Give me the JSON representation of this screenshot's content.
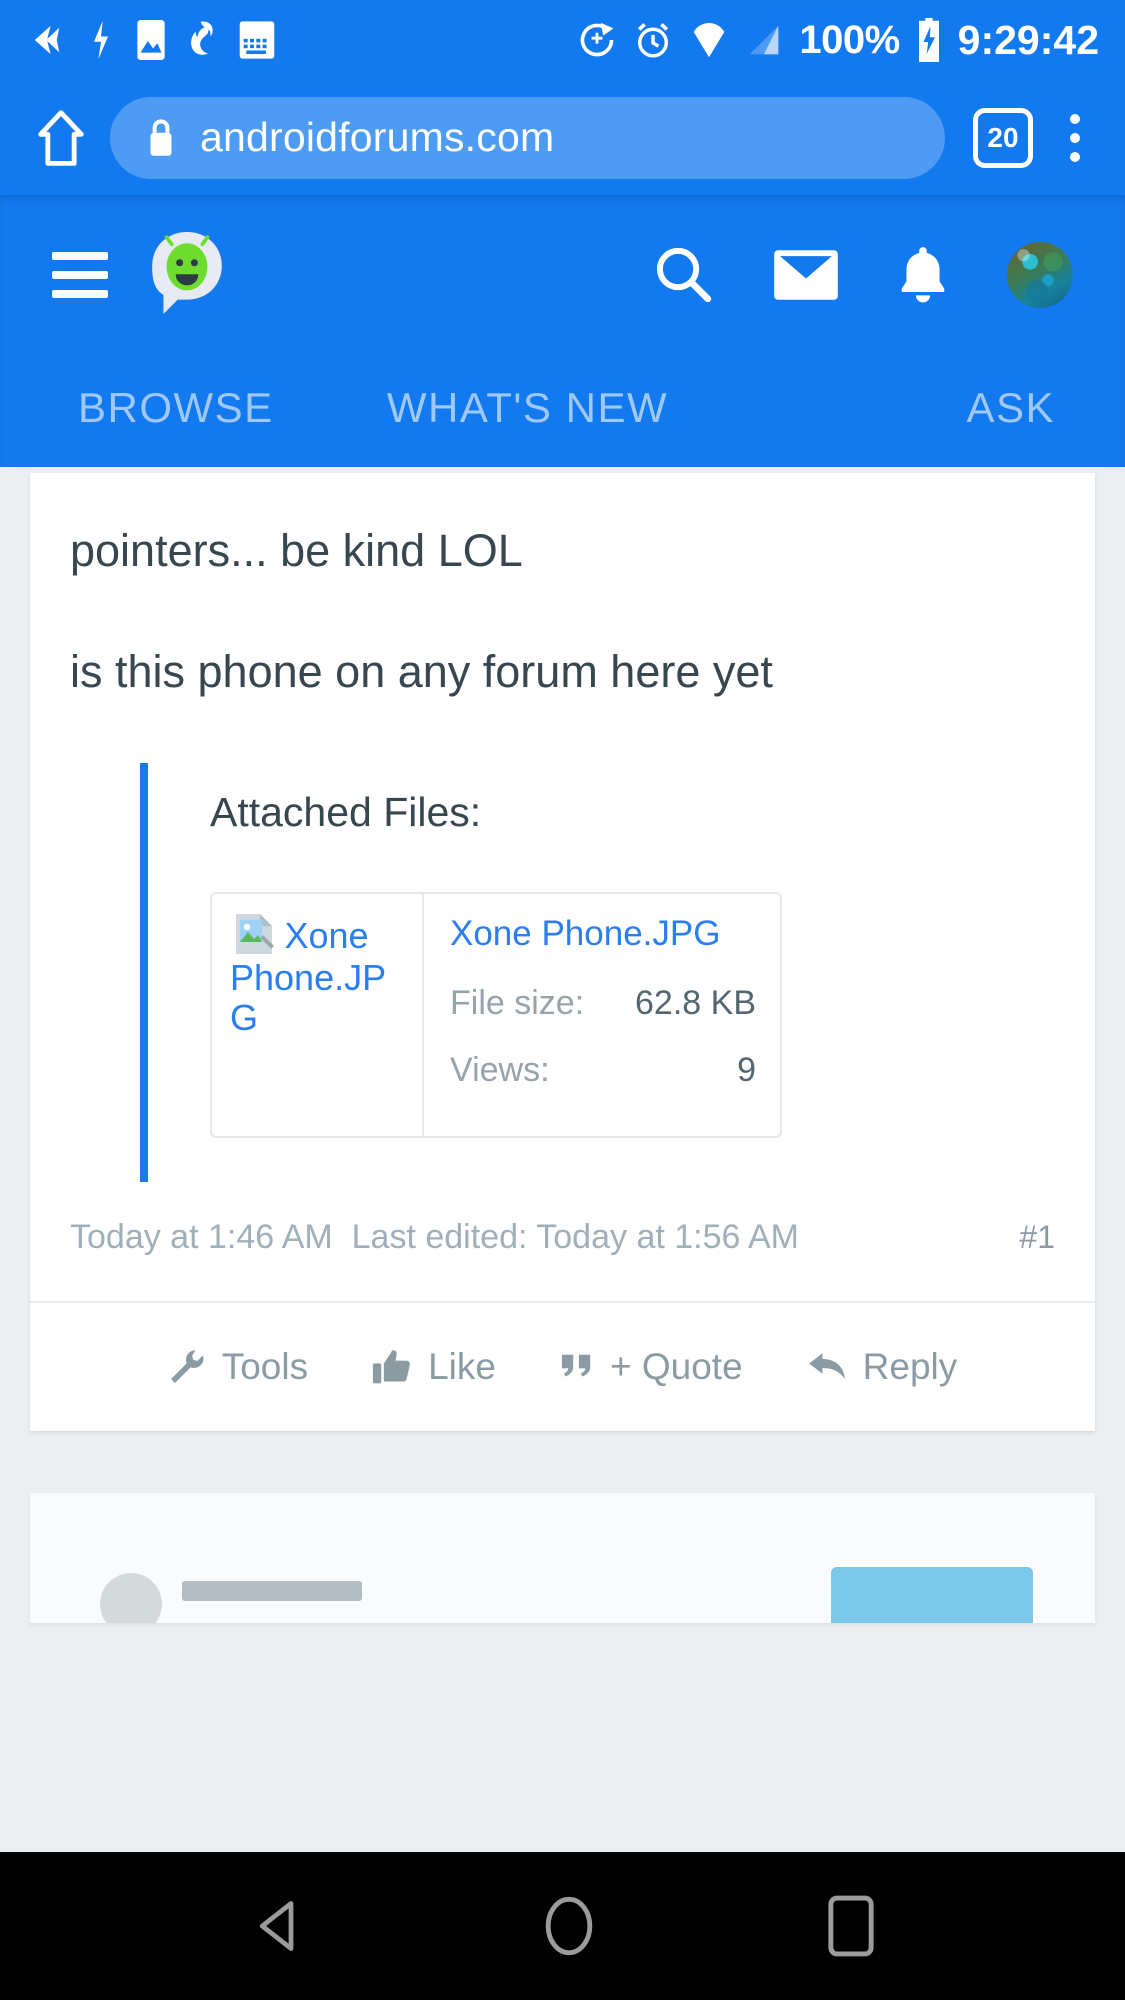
{
  "status_bar": {
    "icons": [
      "back-arrow-icon",
      "flash-icon",
      "photo-icon",
      "firefox-icon",
      "keyboard-icon",
      "sync-icon",
      "alarm-icon",
      "location-icon",
      "signal-icon"
    ],
    "battery_percent": "100%",
    "battery_icon": "battery-charging-icon",
    "clock": "9:29:42"
  },
  "browser": {
    "home_icon": "home-icon",
    "lock_icon": "lock-icon",
    "url": "androidforums.com",
    "tab_count": "20",
    "menu_icon": "kebab-menu-icon"
  },
  "forum_header": {
    "menu_icon": "hamburger-menu-icon",
    "logo_icon": "android-forums-logo-icon",
    "actions": [
      "search-icon",
      "inbox-icon",
      "bell-icon",
      "avatar"
    ],
    "tabs": [
      {
        "label": "BROWSE"
      },
      {
        "label": "WHAT'S NEW"
      },
      {
        "label": "ASK"
      }
    ]
  },
  "post": {
    "paragraphs": [
      "pointers... be kind LOL",
      "is this phone on any forum here yet"
    ],
    "attachments_title": "Attached Files:",
    "attachment": {
      "thumb_alt": "Xone Phone.JPG",
      "thumb_icon": "broken-image-icon",
      "name": "Xone Phone.JPG",
      "filesize_label": "File size:",
      "filesize_value": "62.8 KB",
      "views_label": "Views:",
      "views_value": "9"
    },
    "posted_at": "Today at 1:46 AM",
    "last_edited": "Last edited: Today at 1:56 AM",
    "post_number": "#1",
    "actions": [
      {
        "label": "Tools",
        "icon": "wrench-icon"
      },
      {
        "label": "Like",
        "icon": "thumbs-up-icon"
      },
      {
        "label": "+ Quote",
        "icon": "quote-icon"
      },
      {
        "label": "Reply",
        "icon": "reply-arrow-icon"
      }
    ]
  },
  "nav_bar": {
    "back_icon": "back-triangle-icon",
    "home_icon": "home-circle-icon",
    "recents_icon": "recents-square-icon"
  },
  "colors": {
    "brand_blue": "#1379ee",
    "omnibox_blue": "#4e9bf4",
    "link_blue": "#2a7ef0",
    "text_dark": "#37474f",
    "muted": "#95a3ab",
    "page_bg": "#eceff1"
  }
}
